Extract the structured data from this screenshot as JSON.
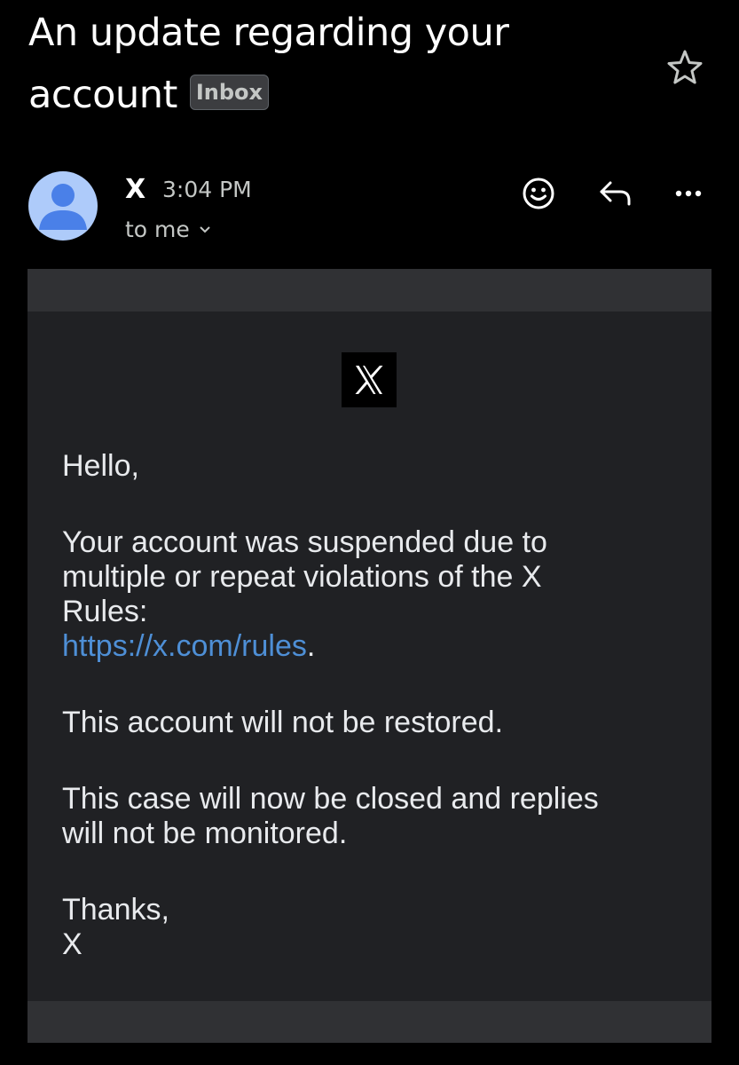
{
  "email": {
    "subject_line1": "An update regarding your",
    "subject_line2": "account",
    "label": "Inbox",
    "sender": "X",
    "time": "3:04 PM",
    "recipient": "to me",
    "logo_text": "X",
    "body": {
      "greeting": "Hello,",
      "para1_line1": "Your account was suspended due to",
      "para1_line2": "multiple or repeat violations of the X",
      "para1_line3": "Rules:",
      "link": "https://x.com/rules",
      "link_suffix": ".",
      "para2": "This account will not be restored.",
      "para3_line1": "This case will now be closed and replies",
      "para3_line2": "will not be monitored.",
      "signoff": "Thanks,",
      "signature": "X"
    }
  },
  "icons": {
    "star": "star-outline-icon",
    "avatar": "person-avatar-icon",
    "recipient_toggle": "chevron-down-icon",
    "emoji": "emoji-reaction-icon",
    "reply": "reply-icon",
    "more": "more-horizontal-icon"
  },
  "colors": {
    "background": "#000000",
    "email_card": "#202124",
    "card_margin": "#303134",
    "link": "#4e8fd6",
    "avatar_bg": "#aecbfa",
    "avatar_fg": "#4a80e8"
  }
}
